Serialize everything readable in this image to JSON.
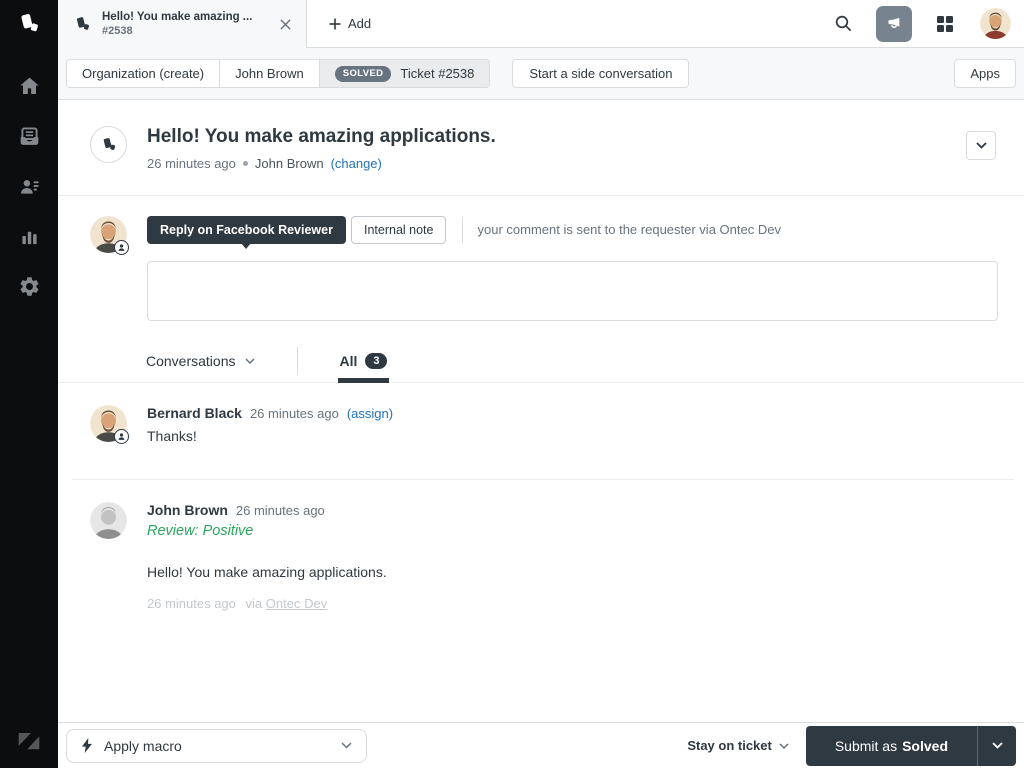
{
  "tab_bar": {
    "active_tab": {
      "title": "Hello! You make amazing ...",
      "subtitle": "#2538"
    },
    "add_label": "Add"
  },
  "toolbar_row": {
    "org_button": "Organization (create)",
    "requester_button": "John Brown",
    "status_badge": "SOLVED",
    "ticket_button": "Ticket #2538",
    "side_conversation_button": "Start a side conversation",
    "apps_button": "Apps"
  },
  "ticket_header": {
    "title": "Hello! You make amazing applications.",
    "timestamp": "26 minutes ago",
    "requester": "John Brown",
    "change_link": "(change)"
  },
  "composer": {
    "reply_tab": "Reply on Facebook Reviewer",
    "internal_note_tab": "Internal note",
    "hint": "your comment is sent to the requester via Ontec Dev"
  },
  "conversation_bar": {
    "conversations_label": "Conversations",
    "all_tab": "All",
    "all_count": "3"
  },
  "messages": [
    {
      "author": "Bernard Black",
      "timestamp": "26 minutes ago",
      "action_link": "(assign)",
      "body": "Thanks!"
    },
    {
      "author": "John Brown",
      "timestamp": "26 minutes ago",
      "review": "Review: Positive",
      "body": "Hello! You make amazing applications.",
      "footer_timestamp": "26 minutes ago",
      "footer_via": "via",
      "footer_channel": "Ontec Dev"
    }
  ],
  "footer": {
    "apply_macro": "Apply macro",
    "stay_on_ticket": "Stay on ticket",
    "submit_label": "Submit as",
    "submit_status": "Solved"
  },
  "colors": {
    "accent_blue": "#1f73b7",
    "success_green": "#2aa35c",
    "dark_slate": "#2f3941",
    "status_badge_gray": "#67737e",
    "sidebar_black": "#0b0d0e"
  }
}
